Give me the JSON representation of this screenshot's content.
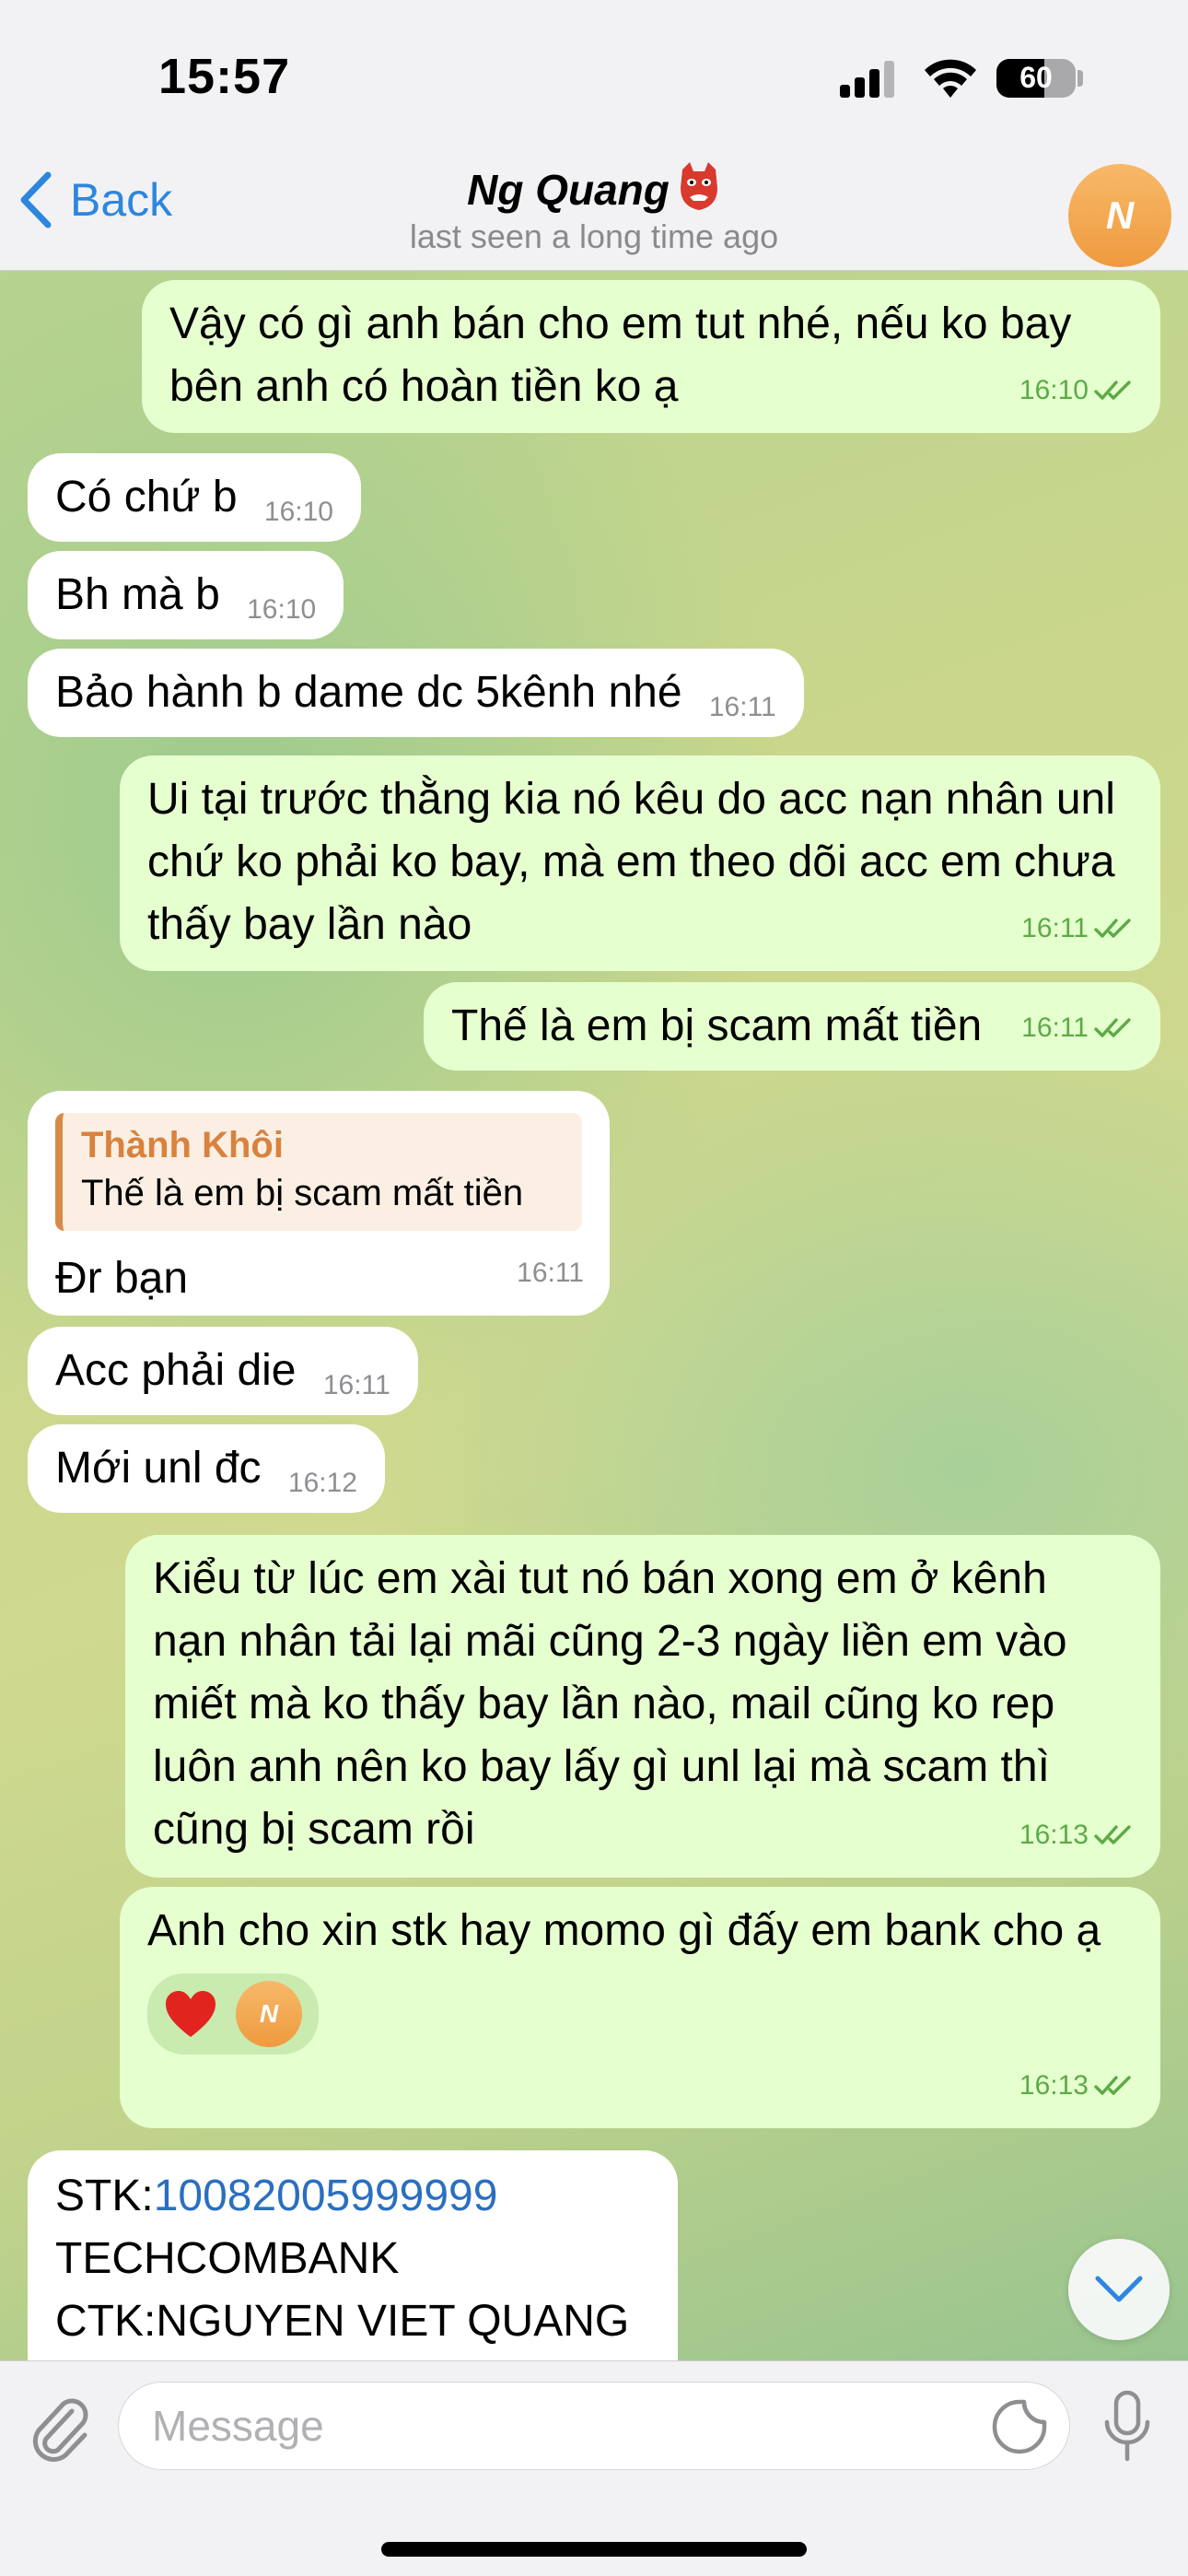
{
  "status_bar": {
    "time": "15:57",
    "battery": "60",
    "battery_fraction": 0.6
  },
  "header": {
    "back_label": "Back",
    "contact_name": "Ng Quang",
    "contact_emoji": "goblin-mask-icon",
    "last_seen": "last seen a long time ago",
    "avatar_initial": "N"
  },
  "messages": [
    {
      "dir": "out",
      "text": "Vậy có gì anh bán cho em tut nhé, nếu ko bay bên anh có hoàn tiền ko ạ",
      "time": "16:10",
      "read": true
    },
    {
      "dir": "in",
      "text": "Có chứ b",
      "time": "16:10"
    },
    {
      "dir": "in",
      "text": "Bh mà b",
      "time": "16:10"
    },
    {
      "dir": "in",
      "text": "Bảo hành b dame dc 5kênh nhé",
      "time": "16:11"
    },
    {
      "dir": "out",
      "text": "Ui tại trước thằng kia nó kêu do acc nạn nhân unl chứ ko phải ko bay, mà em theo dõi acc em chưa thấy bay lần nào",
      "time": "16:11",
      "read": true
    },
    {
      "dir": "out",
      "text": "Thế là em bị scam mất tiền",
      "time": "16:11",
      "read": true
    },
    {
      "dir": "in",
      "reply_to": {
        "name": "Thành Khôi",
        "text": "Thế là em bị scam mất tiền"
      },
      "text": "Đr bạn",
      "time": "16:11"
    },
    {
      "dir": "in",
      "text": "Acc phải die",
      "time": "16:11"
    },
    {
      "dir": "in",
      "text": "Mới unl đc",
      "time": "16:12"
    },
    {
      "dir": "out",
      "text": "Kiểu từ lúc em xài tut nó bán xong em ở kênh nạn nhân tải lại mãi cũng 2-3 ngày liền em vào miết mà ko thấy bay lần nào, mail cũng ko rep luôn anh nên ko bay lấy gì unl lại mà scam thì cũng bị scam rồi",
      "time": "16:13",
      "read": true
    },
    {
      "dir": "out",
      "text": "Anh cho xin stk hay momo gì đấy em bank cho ạ",
      "time": "16:13",
      "read": true,
      "reaction": {
        "emoji": "heart-icon",
        "by": "N"
      }
    },
    {
      "dir": "in",
      "lines": [
        {
          "label": "STK:",
          "value": "10082005999999"
        },
        {
          "text": "TECHCOMBANK"
        },
        {
          "text": "CTK:NGUYEN VIET QUANG"
        }
      ]
    }
  ],
  "input": {
    "placeholder": "Message"
  },
  "colors": {
    "outgoing_bubble": "#e6ffcf",
    "incoming_bubble": "#ffffff",
    "accent": "#2e86de",
    "timestamp_out": "#5caa47",
    "reply_name": "#d9823e"
  }
}
